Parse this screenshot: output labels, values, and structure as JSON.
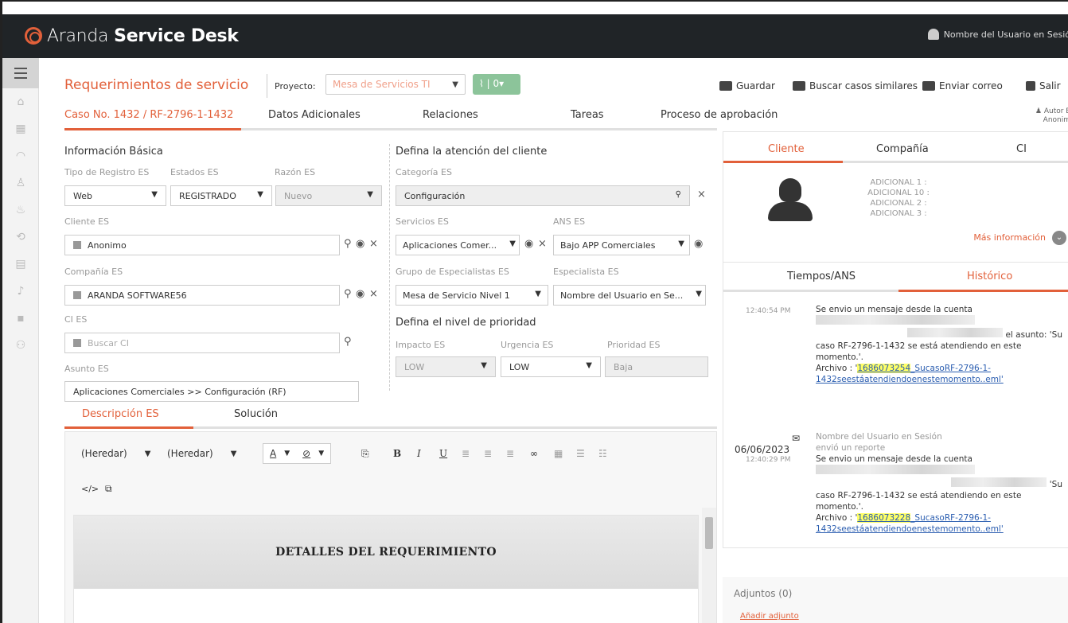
{
  "app": {
    "brand_a": "Aranda",
    "brand_b": "Service Desk",
    "user": "Nombre del Usuario en Sesió"
  },
  "header": {
    "title": "Requerimientos de servicio",
    "project_label": "Proyecto:",
    "project_value": "Mesa de Servicios TI",
    "rss_count": "0",
    "toolbar": {
      "save": "Guardar",
      "similar": "Buscar casos similares",
      "email": "Enviar correo",
      "exit": "Salir"
    }
  },
  "tabs": [
    "Caso No. 1432 / RF-2796-1-1432",
    "Datos Adicionales",
    "Relaciones",
    "Tareas",
    "Proceso de aprobación"
  ],
  "autor": {
    "l1": "Autor E",
    "l2": "Anonim"
  },
  "form": {
    "basic_title": "Información Básica",
    "tipo_label": "Tipo de Registro ES",
    "tipo_value": "Web",
    "estados_label": "Estados ES",
    "estados_value": "REGISTRADO",
    "razon_label": "Razón ES",
    "razon_value": "Nuevo",
    "cliente_label": "Cliente ES",
    "cliente_value": "Anonimo",
    "compania_label": "Compañía ES",
    "compania_value": "ARANDA SOFTWARE56",
    "ci_label": "CI ES",
    "ci_placeholder": "Buscar CI",
    "asunto_label": "Asunto ES",
    "asunto_value": "Aplicaciones Comerciales >> Configuración (RF)",
    "atencion_title": "Defina la atención del cliente",
    "categoria_label": "Categoría ES",
    "categoria_value": "Configuración",
    "servicios_label": "Servicios ES",
    "servicios_value": "Aplicaciones Comer...",
    "ans_label": "ANS ES",
    "ans_value": "Bajo APP Comerciales",
    "grupo_label": "Grupo de Especialistas ES",
    "grupo_value": "Mesa de Servicio Nivel 1",
    "especialista_label": "Especialista ES",
    "especialista_value": "Nombre del Usuario en Se...",
    "prioridad_title": "Defina el nivel de prioridad",
    "impacto_label": "Impacto ES",
    "impacto_value": "LOW",
    "urgencia_label": "Urgencia ES",
    "urgencia_value": "LOW",
    "prioridad_label": "Prioridad ES",
    "prioridad_value": "Baja"
  },
  "desc_tabs": [
    "Descripción ES",
    "Solución"
  ],
  "editor": {
    "font1": "(Heredar)",
    "font2": "(Heredar)",
    "heading": "DETALLES DEL REQUERIMIENTO"
  },
  "right": {
    "tabs": [
      "Cliente",
      "Compañía",
      "CI"
    ],
    "adicional": [
      "ADICIONAL 1 :",
      "ADICIONAL 10 :",
      "ADICIONAL 2 :",
      "ADICIONAL 3 :"
    ],
    "more": "Más información",
    "tabs2": [
      "Tiempos/ANS",
      "Histórico"
    ],
    "h1": {
      "time": "12:40:54 PM",
      "l1": "Se envio un mensaje desde la cuenta",
      "l2": "el asunto: 'Su",
      "l3": "caso RF-2796-1-1432 se está atendiendo en este",
      "l4": "momento.'.",
      "arch": "Archivo : '",
      "file_a": "1686073254",
      "file_b": "_SucasoRF-2796-1-",
      "file_c": "1432seestáatendiendoenestemomento..eml'"
    },
    "h2": {
      "date": "06/06/2023",
      "time": "12:40:29 PM",
      "user": "Nombre del Usuario en Sesión",
      "act": "envió un reporte",
      "l1": "Se envio un mensaje desde la cuenta",
      "l2": "'Su",
      "l3": "caso RF-2796-1-1432 se está atendiendo en este",
      "l4": "momento.'.",
      "arch": "Archivo : '",
      "file_a": "1686073228",
      "file_b": "_SucasoRF-2796-1-",
      "file_c": "1432seestáatendiendoenestemomento..eml'"
    },
    "adjuntos": "Adjuntos (0)",
    "add": "Añadir adjunto"
  }
}
